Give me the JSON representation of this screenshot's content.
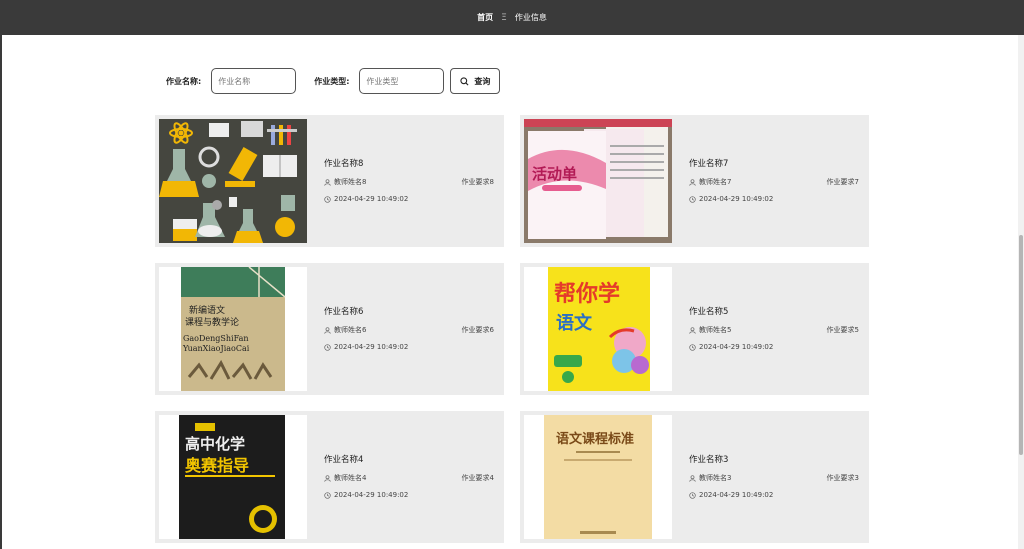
{
  "header": {
    "home": "首页",
    "separator": "Ξ",
    "current": "作业信息"
  },
  "search": {
    "name_label": "作业名称:",
    "name_placeholder": "作业名称",
    "type_label": "作业类型:",
    "type_placeholder": "作业类型",
    "button_label": "查询"
  },
  "homeworks": [
    {
      "title": "作业名称8",
      "teacher": "教师姓名8",
      "requirement": "作业要求8",
      "time": "2024-04-29 10:49:02"
    },
    {
      "title": "作业名称7",
      "teacher": "教师姓名7",
      "requirement": "作业要求7",
      "time": "2024-04-29 10:49:02"
    },
    {
      "title": "作业名称6",
      "teacher": "教师姓名6",
      "requirement": "作业要求6",
      "time": "2024-04-29 10:49:02"
    },
    {
      "title": "作业名称5",
      "teacher": "教师姓名5",
      "requirement": "作业要求5",
      "time": "2024-04-29 10:49:02"
    },
    {
      "title": "作业名称4",
      "teacher": "教师姓名4",
      "requirement": "作业要求4",
      "time": "2024-04-29 10:49:02"
    },
    {
      "title": "作业名称3",
      "teacher": "教师姓名3",
      "requirement": "作业要求3",
      "time": "2024-04-29 10:49:02"
    }
  ],
  "covers": {
    "c6_title1": "新编语文",
    "c6_title2": "课程与教学论",
    "c6_py1": "GaoDengShiFan",
    "c6_py2": "YuanXiaoJiaoCai",
    "c5_t1": "帮你学",
    "c5_t2": "语文",
    "c4_t1": "高中化学",
    "c4_t2": "奥赛指导",
    "c3_t1": "语文课程标准",
    "c7_t1": "活动单"
  },
  "icons": {
    "user": "user-icon",
    "clock": "clock-icon",
    "search": "search-icon"
  },
  "colors": {
    "topbar": "#3a3a3a",
    "card": "#ececec"
  }
}
